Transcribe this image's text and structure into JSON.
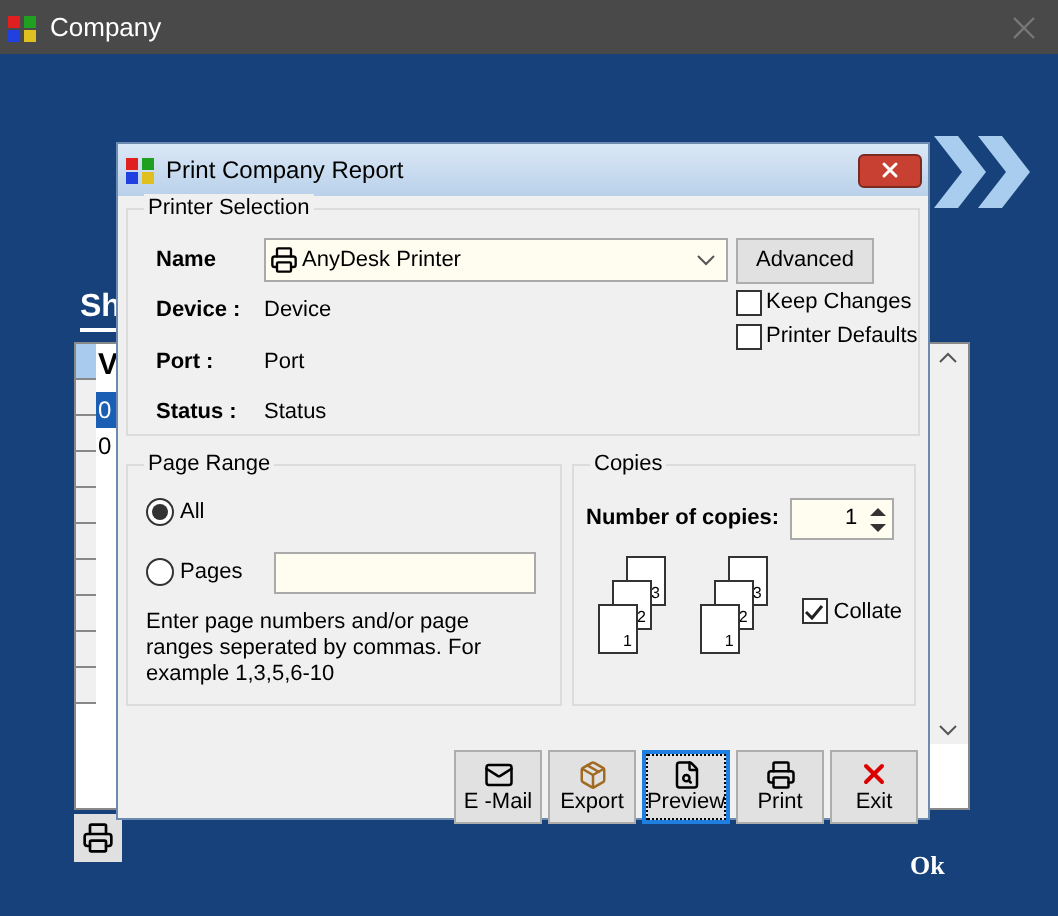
{
  "window": {
    "title": "Company"
  },
  "background": {
    "tab_label": "Sh",
    "column_header": "V",
    "rows": [
      {
        "cell": "0",
        "selected": true
      },
      {
        "cell": "0",
        "selected": false
      }
    ],
    "ok": "Ok"
  },
  "dialog": {
    "title": "Print Company Report",
    "printer_selection": {
      "legend": "Printer Selection",
      "name_label": "Name",
      "printer": "AnyDesk Printer",
      "advanced": "Advanced",
      "options": [
        {
          "label": "Keep Changes",
          "checked": false
        },
        {
          "label": "Printer Defaults",
          "checked": false
        }
      ],
      "details": [
        {
          "label": "Device :",
          "value": "Device"
        },
        {
          "label": "Port :",
          "value": "Port"
        },
        {
          "label": "Status :",
          "value": "Status"
        }
      ]
    },
    "page_range": {
      "legend": "Page Range",
      "options": [
        {
          "label": "All",
          "selected": true
        },
        {
          "label": "Pages",
          "selected": false
        }
      ],
      "hint": "Enter page numbers and/or page ranges seperated by commas. For example 1,3,5,6-10"
    },
    "copies": {
      "legend": "Copies",
      "label": "Number of copies:",
      "value": "1",
      "stacks": [
        {
          "pages": [
            "3",
            "2",
            "1"
          ]
        },
        {
          "pages": [
            "3",
            "2",
            "1"
          ]
        }
      ],
      "collate": {
        "label": "Collate",
        "checked": true
      }
    },
    "buttons": [
      {
        "label": "E -Mail",
        "kind": "email",
        "default": false
      },
      {
        "label": "Export",
        "kind": "export",
        "default": false
      },
      {
        "label": "Preview",
        "kind": "preview",
        "default": true
      },
      {
        "label": "Print",
        "kind": "print",
        "default": false
      },
      {
        "label": "Exit",
        "kind": "exit",
        "default": false
      }
    ]
  }
}
